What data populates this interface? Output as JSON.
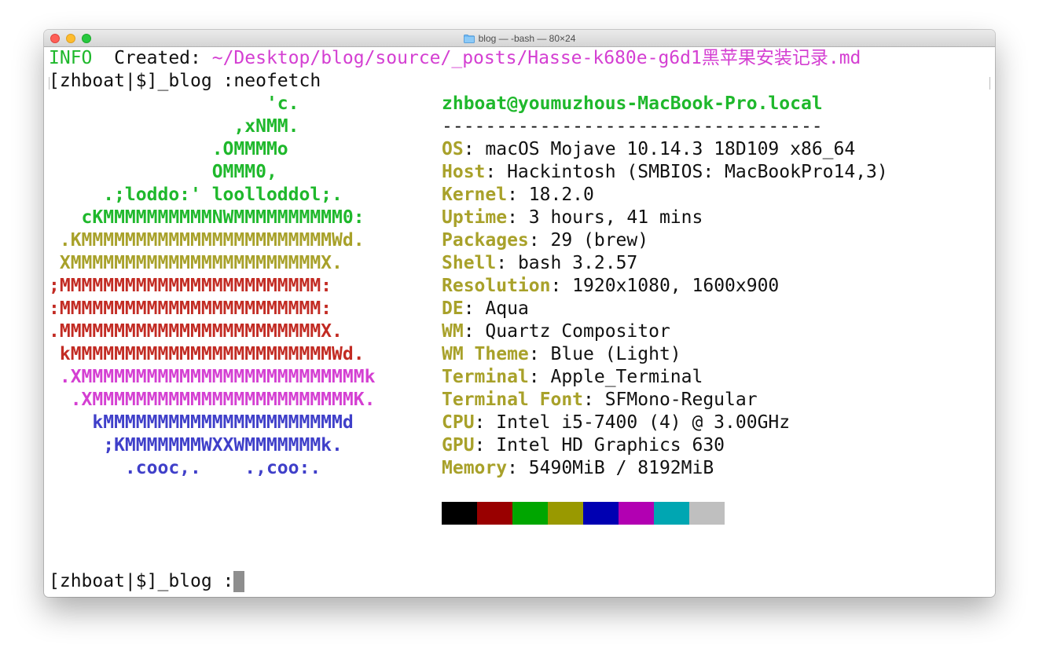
{
  "window": {
    "title": "blog — -bash — 80×24",
    "title_icon": "folder-icon"
  },
  "lines": {
    "info_tag": "INFO",
    "created_label": "  Created: ",
    "created_path": "~/Desktop/blog/source/_posts/Hasse-k680e-g6d1黑苹果安装记录.md",
    "prompt1": "[zhboat|$]_blog :neofetch",
    "prompt2": "[zhboat|$]_blog :"
  },
  "logo": [
    {
      "text": "                    'c.",
      "color": "#1fb82c"
    },
    {
      "text": "                 ,xNMM.",
      "color": "#1fb82c"
    },
    {
      "text": "               .OMMMMo",
      "color": "#1fb82c"
    },
    {
      "text": "               OMMM0,",
      "color": "#1fb82c"
    },
    {
      "text": "     .;loddo:' loolloddol;.",
      "color": "#1fb82c"
    },
    {
      "text": "   cKMMMMMMMMMMNWMMMMMMMMMM0:",
      "color": "#1fb82c"
    },
    {
      "text": " .KMMMMMMMMMMMMMMMMMMMMMMMWd.",
      "color": "#a8a12a"
    },
    {
      "text": " XMMMMMMMMMMMMMMMMMMMMMMMX.",
      "color": "#a8a12a"
    },
    {
      "text": ";MMMMMMMMMMMMMMMMMMMMMMMM:",
      "color": "#c22b23"
    },
    {
      "text": ":MMMMMMMMMMMMMMMMMMMMMMMM:",
      "color": "#c22b23"
    },
    {
      "text": ".MMMMMMMMMMMMMMMMMMMMMMMMX.",
      "color": "#c22b23"
    },
    {
      "text": " kMMMMMMMMMMMMMMMMMMMMMMMMWd.",
      "color": "#c22b23"
    },
    {
      "text": " .XMMMMMMMMMMMMMMMMMMMMMMMMMMk",
      "color": "#d43fd2"
    },
    {
      "text": "  .XMMMMMMMMMMMMMMMMMMMMMMMMK.",
      "color": "#d43fd2"
    },
    {
      "text": "    kMMMMMMMMMMMMMMMMMMMMMMd",
      "color": "#3f3fc9"
    },
    {
      "text": "     ;KMMMMMMMWXXWMMMMMMMk.",
      "color": "#3f3fc9"
    },
    {
      "text": "       .cooc,.    .,coo:.",
      "color": "#3f3fc9"
    }
  ],
  "sysinfo": {
    "user_host": "zhboat@youmuzhous-MacBook-Pro.local",
    "separator": "-----------------------------------",
    "key_color": "#a8a12a",
    "items": [
      {
        "key": "OS",
        "value": ": macOS Mojave 10.14.3 18D109 x86_64"
      },
      {
        "key": "Host",
        "value": ": Hackintosh (SMBIOS: MacBookPro14,3)"
      },
      {
        "key": "Kernel",
        "value": ": 18.2.0"
      },
      {
        "key": "Uptime",
        "value": ": 3 hours, 41 mins"
      },
      {
        "key": "Packages",
        "value": ": 29 (brew)"
      },
      {
        "key": "Shell",
        "value": ": bash 3.2.57"
      },
      {
        "key": "Resolution",
        "value": ": 1920x1080, 1600x900"
      },
      {
        "key": "DE",
        "value": ": Aqua"
      },
      {
        "key": "WM",
        "value": ": Quartz Compositor"
      },
      {
        "key": "WM Theme",
        "value": ": Blue (Light)"
      },
      {
        "key": "Terminal",
        "value": ": Apple_Terminal"
      },
      {
        "key": "Terminal Font",
        "value": ": SFMono-Regular"
      },
      {
        "key": "CPU",
        "value": ": Intel i5-7400 (4) @ 3.00GHz"
      },
      {
        "key": "GPU",
        "value": ": Intel HD Graphics 630"
      },
      {
        "key": "Memory",
        "value": ": 5490MiB / 8192MiB"
      }
    ]
  },
  "palette": [
    "#000000",
    "#990000",
    "#00a600",
    "#999900",
    "#0000b2",
    "#b200b2",
    "#00a6b2",
    "#bfbfbf"
  ],
  "colors": {
    "info_tag": "#1fb82c",
    "path": "#d43fd2"
  }
}
